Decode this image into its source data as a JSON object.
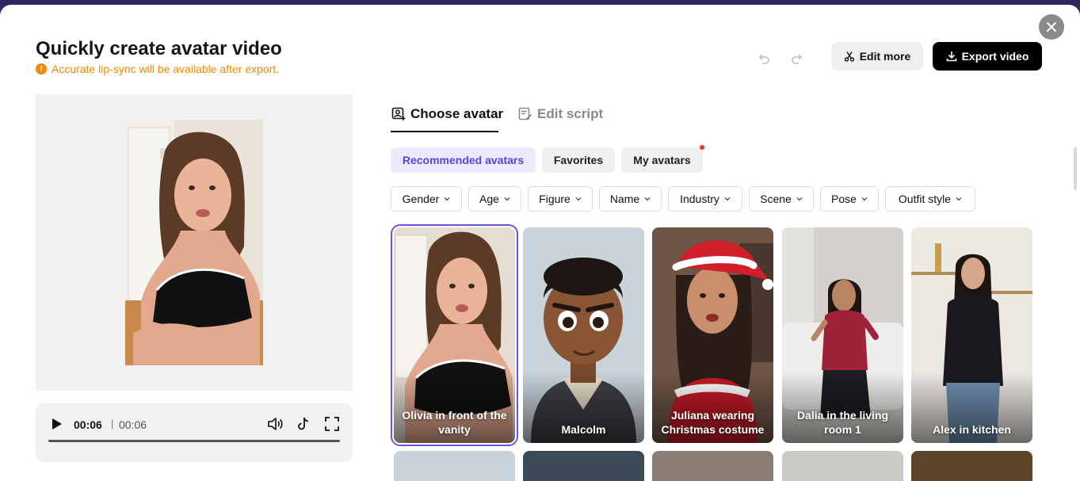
{
  "header": {
    "title": "Quickly create avatar video",
    "warning": "Accurate lip-sync will be available after export.",
    "edit_more_label": "Edit more",
    "export_label": "Export video"
  },
  "player": {
    "current_time": "00:06",
    "separator": "|",
    "total_time": "00:06",
    "progress": 1.0
  },
  "tabs": [
    {
      "label": "Choose avatar",
      "active": true
    },
    {
      "label": "Edit script",
      "active": false
    }
  ],
  "chips": [
    {
      "label": "Recommended avatars",
      "active": true
    },
    {
      "label": "Favorites",
      "active": false
    },
    {
      "label": "My avatars",
      "active": false,
      "notification_dot": true
    }
  ],
  "filters": [
    "Gender",
    "Age",
    "Figure",
    "Name",
    "Industry",
    "Scene",
    "Pose",
    "Outfit style"
  ],
  "avatars": [
    {
      "name": "Olivia in front of the vanity",
      "selected": true
    },
    {
      "name": "Malcolm",
      "selected": false
    },
    {
      "name": "Juliana wearing Christmas costume",
      "selected": false
    },
    {
      "name": "Dalia in the living room 1",
      "selected": false
    },
    {
      "name": "Alex in kitchen",
      "selected": false
    }
  ],
  "colors": {
    "accent": "#6b55e0",
    "warning": "#f08a00",
    "export_bg": "#000000"
  }
}
